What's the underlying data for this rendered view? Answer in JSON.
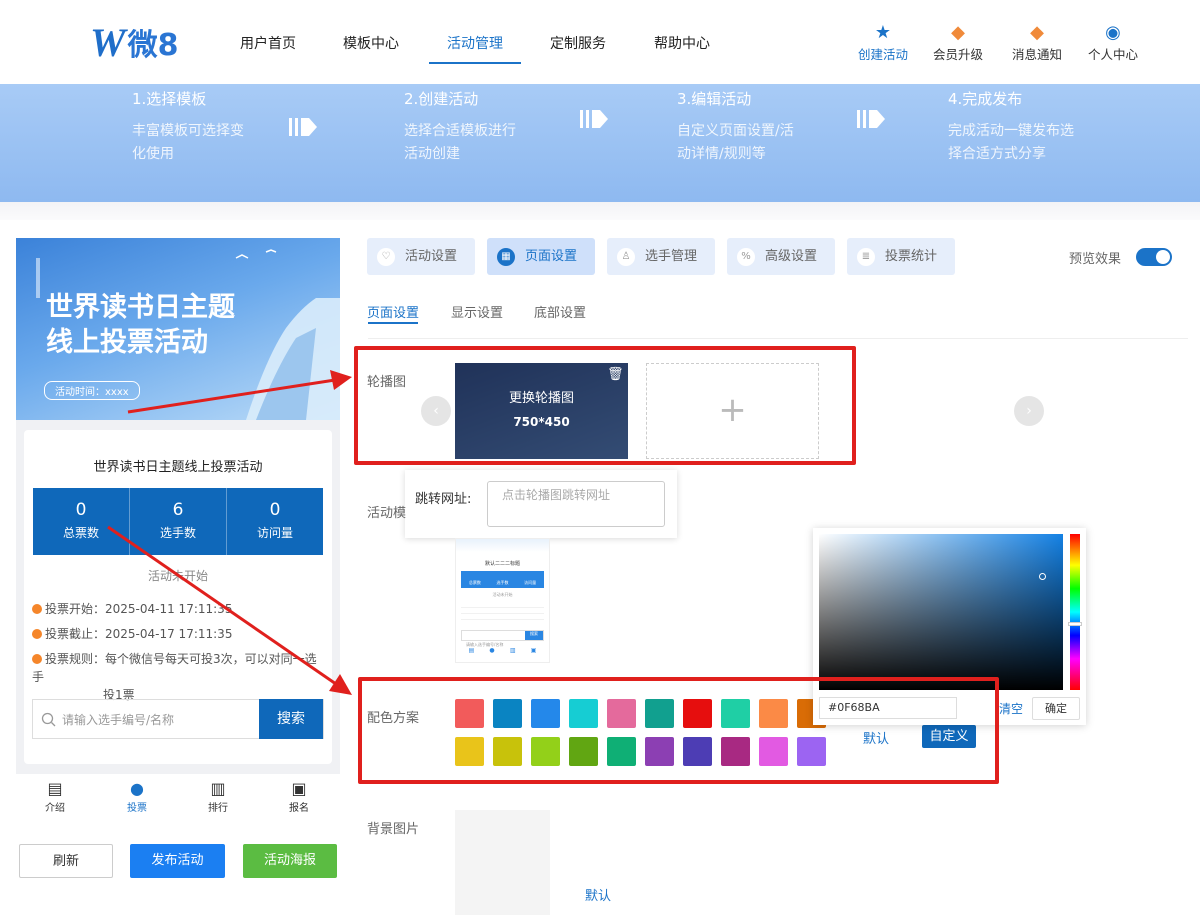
{
  "header": {
    "logo_w": "W",
    "logo_text": "微8",
    "nav": [
      "用户首页",
      "模板中心",
      "活动管理",
      "定制服务",
      "帮助中心"
    ],
    "actions": [
      {
        "label": "创建活动",
        "icon": "star-icon",
        "color": "#1b73c8"
      },
      {
        "label": "会员升级",
        "icon": "diamond-icon",
        "color": "#f08a3a"
      },
      {
        "label": "消息通知",
        "icon": "bell-icon",
        "color": "#f08a3a"
      },
      {
        "label": "个人中心",
        "icon": "user-icon",
        "color": "#1b73c8"
      }
    ]
  },
  "steps": [
    {
      "title": "1.选择模板",
      "desc": "丰富模板可选择变化使用"
    },
    {
      "title": "2.创建活动",
      "desc": "选择合适模板进行活动创建"
    },
    {
      "title": "3.编辑活动",
      "desc": "自定义页面设置/活动详情/规则等"
    },
    {
      "title": "4.完成发布",
      "desc": "完成活动一键发布选择合适方式分享"
    }
  ],
  "preview": {
    "poster_title_1": "世界读书日主题",
    "poster_title_2": "线上投票活动",
    "poster_time": "活动时间：xxxx",
    "activity_title": "世界读书日主题线上投票活动",
    "stats": [
      {
        "value": "0",
        "label": "总票数"
      },
      {
        "value": "6",
        "label": "选手数"
      },
      {
        "value": "0",
        "label": "访问量"
      }
    ],
    "status": "活动未开始",
    "vote_start": "投票开始：2025-04-11 17:11:35",
    "vote_end": "投票截止：2025-04-17 17:11:35",
    "vote_rule_1": "投票规则：每个微信号每天可投3次，可以对同一选手",
    "vote_rule_2": "投1票",
    "search_placeholder": "请输入选手编号/名称",
    "search_button": "搜索",
    "tabbar": [
      {
        "label": "介绍",
        "icon": "doc-icon"
      },
      {
        "label": "投票",
        "icon": "person-icon"
      },
      {
        "label": "排行",
        "icon": "chart-icon"
      },
      {
        "label": "报名",
        "icon": "form-icon"
      }
    ],
    "buttons": {
      "refresh": "刷新",
      "publish": "发布活动",
      "poster": "活动海报"
    }
  },
  "settings": {
    "tabs": [
      "活动设置",
      "页面设置",
      "选手管理",
      "高级设置",
      "投票统计"
    ],
    "active_tab": "页面设置",
    "preview_toggle_label": "预览效果",
    "subtabs": [
      "页面设置",
      "显示设置",
      "底部设置"
    ],
    "carousel_label": "轮播图",
    "carousel_overlay_1": "更换轮播图",
    "carousel_overlay_2": "750*450",
    "jump_url_label": "跳转网址:",
    "jump_url_placeholder": "点击轮播图跳转网址",
    "template_label": "活动模",
    "color_label": "配色方案",
    "colors_row1": [
      "#f25b5b",
      "#0a84c2",
      "#2488ea",
      "#16cdd3",
      "#e46a9c",
      "#11a08f",
      "#e60e0e",
      "#1fcfa5",
      "#fb8a46",
      "#d96c06"
    ],
    "colors_row2": [
      "#e9c41a",
      "#c8c20b",
      "#93d019",
      "#61a612",
      "#0faf75",
      "#8c3fb3",
      "#4d3db4",
      "#a82982",
      "#e25ae2",
      "#9c64f2"
    ],
    "picker_hex": "#0F68BA",
    "picker_clear": "清空",
    "picker_ok": "确定",
    "default_link": "默认",
    "custom_button": "自定义",
    "bg_label": "背景图片",
    "bg_default": "默认"
  },
  "thumb": {
    "title": "默认二二二标题",
    "stats": [
      "总票数",
      "选手数",
      "访问量"
    ],
    "status": "活动未开始",
    "search": "请输入选手编号/名称",
    "search_btn": "搜索"
  }
}
